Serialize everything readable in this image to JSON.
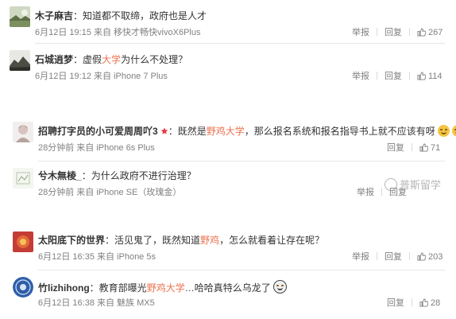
{
  "groups": [
    {
      "comments": [
        {
          "name": "木子麻吉",
          "colon": "：",
          "segments": [
            {
              "t": "知道都不取缔，政府也是人才"
            }
          ],
          "meta": "6月12日 19:15 来自 移快才畅快vivoX6Plus",
          "report": "举报",
          "reply": "回复",
          "likes": "267",
          "avatar": "landscape-avatar"
        },
        {
          "name": "石城逍梦",
          "colon": "：",
          "segments": [
            {
              "t": "虚假"
            },
            {
              "t": "大学",
              "hl": true
            },
            {
              "t": "为什么不处理？"
            }
          ],
          "meta": "6月12日 19:12 来自 iPhone 7 Plus",
          "report": "举报",
          "reply": "回复",
          "likes": "114",
          "avatar": "mountain-avatar"
        }
      ]
    },
    {
      "comments": [
        {
          "name": "招聘打字员的小可爱周周吖3",
          "colon": "：",
          "segments": [
            {
              "t": "既然是"
            },
            {
              "t": "野鸡大学",
              "hl": true
            },
            {
              "t": "，那么报名系统和报名指导书上就不应该有呀"
            }
          ],
          "meta": "28分钟前 来自 iPhone 6s Plus",
          "reply": "回复",
          "likes": "71",
          "avatar": "girl-avatar",
          "vip": true,
          "emoji_count": 3
        },
        {
          "name": "兮木無棱_",
          "colon": "：",
          "segments": [
            {
              "t": "为什么政府不进行治理？"
            }
          ],
          "meta": "28分钟前 来自 iPhone SE（玫瑰金）",
          "report": "举报",
          "reply": "回复",
          "avatar": "sketch-avatar"
        }
      ],
      "watermark": "普斯留学"
    },
    {
      "comments": [
        {
          "name": "太阳底下的世界",
          "colon": "：",
          "segments": [
            {
              "t": "活见鬼了，既然知道"
            },
            {
              "t": "野鸡",
              "hl": true
            },
            {
              "t": "，怎么就看着让存在呢？"
            }
          ],
          "meta": "6月12日 16:35 来自 iPhone 5s",
          "report": "举报",
          "reply": "回复",
          "likes": "203",
          "avatar": "red-avatar"
        },
        {
          "name": "竹lizhihong",
          "colon": "：",
          "segments": [
            {
              "t": "教育部曝光"
            },
            {
              "t": "野鸡大学",
              "hl": true
            },
            {
              "t": "…哈哈真特么乌龙了"
            }
          ],
          "meta": "6月12日 16:38 来自 魅族 MX5",
          "reply": "回复",
          "likes": "28",
          "avatar": "badge-avatar",
          "emoji_count": 1
        }
      ]
    }
  ],
  "colors": {
    "highlight": "#eb7350",
    "meta": "#808080",
    "name": "#333333"
  }
}
